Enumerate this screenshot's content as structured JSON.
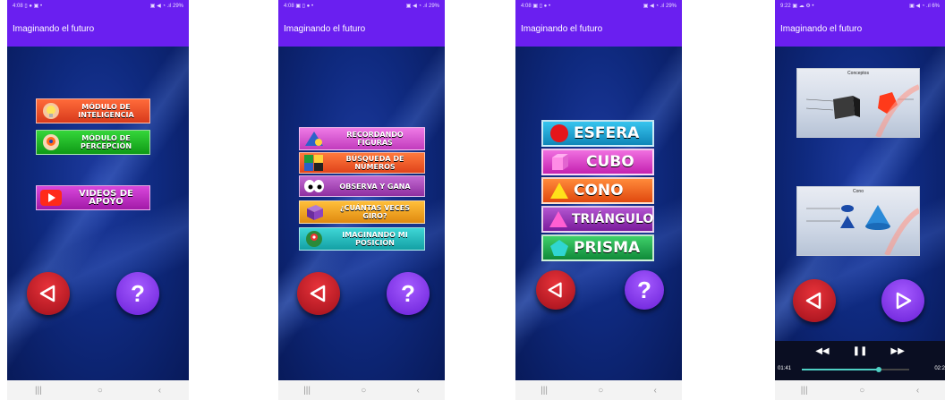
{
  "phones": [
    {
      "status": {
        "time": "4:08",
        "left_icons": "▯ ● ▣ •",
        "right_icons": "▣ ◀ ◔ .ıl",
        "battery": "29%"
      },
      "app_title": "Imaginando el futuro",
      "menu": [
        {
          "label": "MÓDULO DE INTELIGENCIA",
          "icon": "lightbulb-icon",
          "color": "#ef4a2a"
        },
        {
          "label": "MÓDULO DE PERCEPCIÓN",
          "icon": "eye-hand-icon",
          "color": "#14b01a"
        },
        {
          "label": "VIDEOS DE APOYO",
          "icon": "play-icon",
          "color": "#c424c8"
        }
      ]
    },
    {
      "status": {
        "time": "4:08",
        "left_icons": "▣ ▯ ● •",
        "right_icons": "▣ ◀ ◔ .ıl",
        "battery": "29%"
      },
      "app_title": "Imaginando el futuro",
      "menu": [
        {
          "label": "RECORDANDO FIGURAS",
          "icon": "shapes-icon",
          "color": "#dd58d6"
        },
        {
          "label": "BÚSQUEDA DE NÚMEROS",
          "icon": "puzzle-icon",
          "color": "#f26330"
        },
        {
          "label": "OBSERVA Y GANA",
          "icon": "eyes-icon",
          "color": "#b24fc0"
        },
        {
          "label": "¿CUÁNTAS VECES GIRO?",
          "icon": "cube-icon",
          "color": "#f0a21b"
        },
        {
          "label": "IMAGINANDO MI POSICIÓN",
          "icon": "location-icon",
          "color": "#21b8b8"
        }
      ]
    },
    {
      "status": {
        "time": "4:08",
        "left_icons": "▣ ▯ ● •",
        "right_icons": "▣ ◀ ◔ .ıl",
        "battery": "29%"
      },
      "app_title": "Imaginando el futuro",
      "shapes": [
        {
          "label": "ESFERA",
          "icon": "sphere-icon",
          "color": "#18a7d8"
        },
        {
          "label": "CUBO",
          "icon": "cube-icon",
          "color": "#e03ec7"
        },
        {
          "label": "CONO",
          "icon": "cone-icon",
          "color": "#f05a1c"
        },
        {
          "label": "TRIÁNGULO",
          "icon": "triangle-icon",
          "color": "#9a2bb8"
        },
        {
          "label": "PRISMA",
          "icon": "pentagon-icon",
          "color": "#1aa84a"
        }
      ]
    },
    {
      "status": {
        "time": "9:22",
        "left_icons": "▣ ☁ ⚙ •",
        "right_icons": "▣ ◀ ◔ .ıl",
        "battery": "6%"
      },
      "app_title": "Imaginando el futuro",
      "images": [
        {
          "title": "Conceptos"
        },
        {
          "title": "Cono"
        }
      ],
      "player": {
        "time_current": "01:41",
        "time_total": "02:2",
        "progress": 0.72
      }
    }
  ],
  "nav": {
    "recents": "|||",
    "home": "○",
    "back": "‹"
  }
}
